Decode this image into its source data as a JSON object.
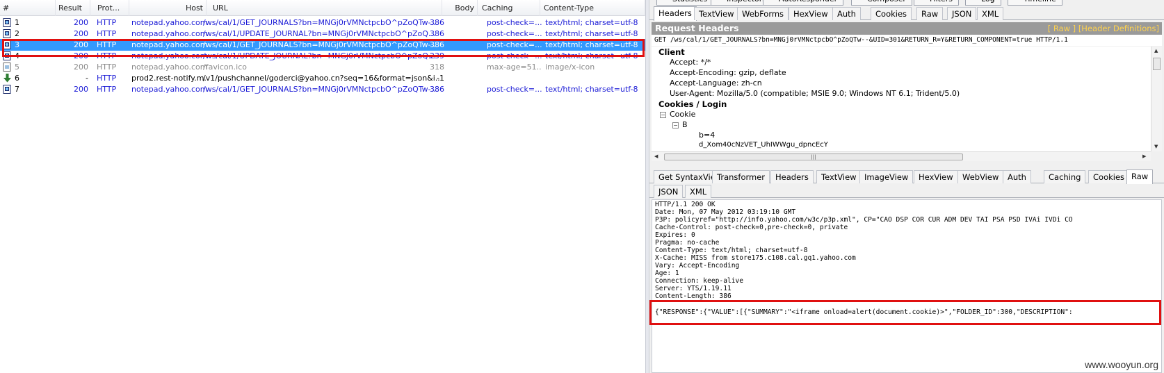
{
  "session_list": {
    "columns": [
      "#",
      "Result",
      "Prot...",
      "Host",
      "URL",
      "Body",
      "Caching",
      "Content-Type"
    ],
    "rows": [
      {
        "id": "1",
        "result": "200",
        "protocol": "HTTP",
        "host": "notepad.yahoo.com",
        "url": "/ws/cal/1/GET_JOURNALS?bn=MNGj0rVMNctpcbO^pZoQTw-...",
        "body": "386",
        "caching": "post-check=...",
        "content_type": "text/html; charset=utf-8",
        "style": "blue",
        "icon": "document-icon"
      },
      {
        "id": "2",
        "result": "200",
        "protocol": "HTTP",
        "host": "notepad.yahoo.com",
        "url": "/ws/cal/1/UPDATE_JOURNAL?bn=MNGj0rVMNctpcbO^pZoQ...",
        "body": "386",
        "caching": "post-check=...",
        "content_type": "text/html; charset=utf-8",
        "style": "blue",
        "icon": "document-icon"
      },
      {
        "id": "3",
        "result": "200",
        "protocol": "HTTP",
        "host": "notepad.yahoo.com",
        "url": "/ws/cal/1/GET_JOURNALS?bn=MNGj0rVMNctpcbO^pZoQTw-...",
        "body": "386",
        "caching": "post-check=...",
        "content_type": "text/html; charset=utf-8",
        "style": "selected",
        "icon": "document-icon"
      },
      {
        "id": "4",
        "result": "200",
        "protocol": "HTTP",
        "host": "notepad.yahoo.com",
        "url": "/ws/cal/1/UPDATE_JOURNAL?bn=MNGj0rVMNctpcbO^pZoQ...",
        "body": "239",
        "caching": "post-check=...",
        "content_type": "text/html; charset=utf-8",
        "style": "blue",
        "icon": "document-icon"
      },
      {
        "id": "5",
        "result": "200",
        "protocol": "HTTP",
        "host": "notepad.yahoo.com",
        "url": "/favicon.ico",
        "body": "318",
        "caching": "max-age=51...",
        "content_type": "image/x-icon",
        "style": "gray",
        "icon": "image-icon"
      },
      {
        "id": "6",
        "result": "-",
        "protocol": "HTTP",
        "host": "prod2.rest-notify.m...",
        "url": "/v1/pushchannel/goderci@yahoo.cn?seq=16&format=json&i...",
        "body": "-1",
        "caching": "",
        "content_type": "",
        "style": "black",
        "icon": "download-arrow-icon"
      },
      {
        "id": "7",
        "result": "200",
        "protocol": "HTTP",
        "host": "notepad.yahoo.com",
        "url": "/ws/cal/1/GET_JOURNALS?bn=MNGj0rVMNctpcbO^pZoQTw-...",
        "body": "386",
        "caching": "post-check=...",
        "content_type": "text/html; charset=utf-8",
        "style": "blue",
        "icon": "document-icon"
      }
    ]
  },
  "top_tabs": [
    "Statistics",
    "Inspectors",
    "AutoResponder",
    "Composer",
    "Filters",
    "Log",
    "Timeline"
  ],
  "request_tabs": [
    "Headers",
    "TextView",
    "WebForms",
    "HexView",
    "Auth",
    "Cookies",
    "Raw",
    "JSON",
    "XML"
  ],
  "request_active_tab": "Headers",
  "request_headers": {
    "title": "Request Headers",
    "links": "[ Raw ]   [Header Definitions]",
    "request_line": "GET /ws/cal/1/GET_JOURNALS?bn=MNGj0rVMNctpcbO^pZoQTw--&UID=301&RETURN_R=Y&RETURN_COMPONENT=true HTTP/1.1",
    "client_title": "Client",
    "client_headers": [
      "Accept: */*",
      "Accept-Encoding: gzip, deflate",
      "Accept-Language: zh-cn",
      "User-Agent: Mozilla/5.0 (compatible; MSIE 9.0; Windows NT 6.1; Trident/5.0)"
    ],
    "cookies_title": "Cookies / Login",
    "cookie_node": "Cookie",
    "cookie_child": "B",
    "cookie_value": "b=4",
    "cookie_partial": "d_Xom40cNzVET_UhIWWgu_dpncEcY"
  },
  "response_tabs_row1": [
    "Get SyntaxView",
    "Transformer",
    "Headers",
    "TextView",
    "ImageView",
    "HexView",
    "WebView",
    "Auth",
    "Caching",
    "Cookies",
    "Raw"
  ],
  "response_tabs_row2": [
    "JSON",
    "XML"
  ],
  "response_active_tab": "Raw",
  "response_raw_headers": "HTTP/1.1 200 OK\nDate: Mon, 07 May 2012 03:19:10 GMT\nP3P: policyref=\"http://info.yahoo.com/w3c/p3p.xml\", CP=\"CAO DSP COR CUR ADM DEV TAI PSA PSD IVAi IVDi CO\nCache-Control: post-check=0,pre-check=0, private\nExpires: 0\nPragma: no-cache\nContent-Type: text/html; charset=utf-8\nX-Cache: MISS from store175.c108.cal.gq1.yahoo.com\nVary: Accept-Encoding\nAge: 1\nConnection: keep-alive\nServer: YTS/1.19.11\nContent-Length: 386",
  "response_json": "{\"RESPONSE\":{\"VALUE\":[{\"SUMMARY\":\"<iframe onload=alert(document.cookie)>\",\"FOLDER_ID\":300,\"DESCRIPTION\":",
  "watermark": "www.wooyun.org",
  "colors": {
    "selected_row": "#3399ff",
    "highlight_box": "#e01010",
    "link_blue": "#1b1bd6",
    "banner_gray": "#9a9a9a",
    "banner_link": "#ffd24d"
  }
}
